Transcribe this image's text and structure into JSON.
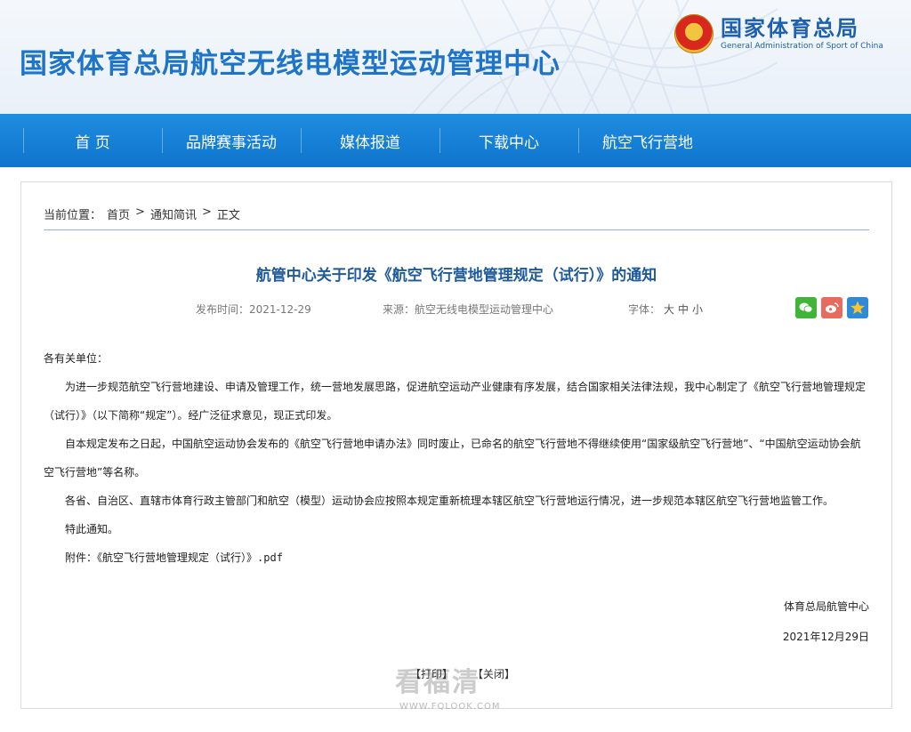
{
  "header": {
    "site_title": "国家体育总局航空无线电模型运动管理中心",
    "gov_cn": "国家体育总局",
    "gov_en": "General Administration of Sport of China"
  },
  "nav": {
    "items": [
      "首 页",
      "品牌赛事活动",
      "媒体报道",
      "下载中心",
      "航空飞行营地"
    ]
  },
  "breadcrumb": {
    "prefix": "当前位置：",
    "home": "首页",
    "sep1": ">",
    "section": "通知简讯",
    "sep2": ">",
    "current": "正文"
  },
  "article": {
    "title": "航管中心关于印发《航空飞行营地管理规定（试行）》的通知",
    "date_label": "发布时间：2021-12-29",
    "source_label": "来源：航空无线电模型运动管理中心",
    "font_label": "字体：",
    "font_large": "大",
    "font_medium": "中",
    "font_small": "小",
    "greeting": "各有关单位：",
    "paragraphs": [
      "为进一步规范航空飞行营地建设、申请及管理工作，统一营地发展思路，促进航空运动产业健康有序发展，结合国家相关法律法规，我中心制定了《航空飞行营地管理规定（试行）》（以下简称“规定”）。经广泛征求意见，现正式印发。",
      "自本规定发布之日起，中国航空运动协会发布的《航空飞行营地申请办法》同时废止，已命名的航空飞行营地不得继续使用“国家级航空飞行营地”、“中国航空运动协会航空飞行营地”等名称。",
      "各省、自治区、直辖市体育行政主管部门和航空（模型）运动协会应按照本规定重新梳理本辖区航空飞行营地运行情况，进一步规范本辖区航空飞行营地监管工作。",
      "特此通知。"
    ],
    "attachment_label": "附件：",
    "attachment_file": "《航空飞行营地管理规定（试行）》.pdf",
    "signature": "体育总局航管中心",
    "sign_date": "2021年12月29日"
  },
  "actions": {
    "print": "【打印】",
    "close": "【关闭】"
  },
  "watermark": {
    "text": "看福清",
    "url": "WWW.FQLOOK.COM"
  },
  "share": {
    "icons": [
      "wechat-icon",
      "weibo-icon",
      "qzone-icon"
    ]
  },
  "colors": {
    "nav_blue": "#1480d6",
    "title_blue": "#1e74c9",
    "article_title": "#1e5a9a"
  }
}
